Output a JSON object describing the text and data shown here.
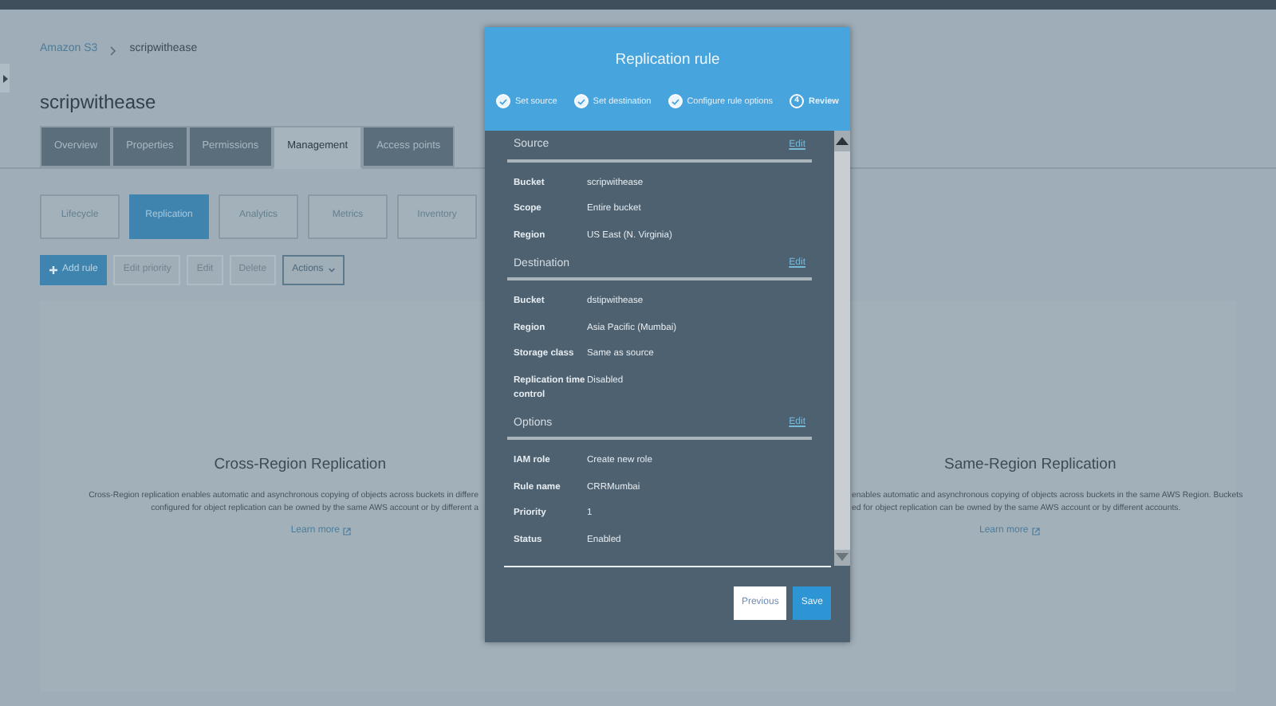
{
  "breadcrumb": [
    "Amazon S3",
    "scripwithease"
  ],
  "bucket_title": "scripwithease",
  "tabs": [
    {
      "label": "Overview",
      "selected": false
    },
    {
      "label": "Properties",
      "selected": false
    },
    {
      "label": "Permissions",
      "selected": false
    },
    {
      "label": "Management",
      "selected": true
    },
    {
      "label": "Access points",
      "selected": false
    }
  ],
  "sub_tabs": [
    {
      "label": "Lifecycle",
      "selected": false
    },
    {
      "label": "Replication",
      "selected": true
    },
    {
      "label": "Analytics",
      "selected": false
    },
    {
      "label": "Metrics",
      "selected": false
    },
    {
      "label": "Inventory",
      "selected": false
    }
  ],
  "toolbar": [
    {
      "label": "Add rule",
      "kind": "primary",
      "disabled": false
    },
    {
      "label": "Edit priority",
      "kind": "plain",
      "disabled": true
    },
    {
      "label": "Edit",
      "kind": "plain",
      "disabled": true
    },
    {
      "label": "Delete",
      "kind": "plain",
      "disabled": true
    },
    {
      "label": "Actions",
      "kind": "dropdown",
      "disabled": false
    }
  ],
  "cards": [
    {
      "title": "Cross-Region Replication",
      "description_lines": [
        "Cross-Region replication enables automatic and asynchronous copying of objects across buckets in differe",
        "configured for object replication can be owned by the same AWS account or by different a"
      ],
      "link": "Learn more"
    },
    {
      "title": "Same-Region Replication",
      "description_lines": [
        "enables automatic and asynchronous copying of objects across buckets in the same AWS Region. Buckets",
        "ed for object replication can be owned by the same AWS account or by different accounts."
      ],
      "link": "Learn more"
    }
  ],
  "modal": {
    "title": "Replication rule",
    "steps": [
      {
        "label": "Set source",
        "done": true,
        "selected": false
      },
      {
        "label": "Set destination",
        "done": true,
        "selected": false
      },
      {
        "label": "Configure rule options",
        "done": true,
        "selected": false
      },
      {
        "label": "Review",
        "done": false,
        "selected": true,
        "number": "4"
      }
    ],
    "sections": [
      {
        "title": "Source",
        "edit": "Edit",
        "fields": [
          {
            "label": "Bucket",
            "value": "scripwithease"
          },
          {
            "label": "Scope",
            "value": "Entire bucket"
          },
          {
            "label": "Region",
            "value": "US East (N. Virginia)"
          }
        ]
      },
      {
        "title": "Destination",
        "edit": "Edit",
        "fields": [
          {
            "label": "Bucket",
            "value": "dstipwithease"
          },
          {
            "label": "Region",
            "value": "Asia Pacific (Mumbai)"
          },
          {
            "label": "Storage class",
            "value": "Same as source"
          },
          {
            "label": "Replication time control",
            "value": "Disabled"
          }
        ]
      },
      {
        "title": "Options",
        "edit": "Edit",
        "fields": [
          {
            "label": "IAM role",
            "value": "Create new role"
          },
          {
            "label": "Rule name",
            "value": "CRRMumbai"
          },
          {
            "label": "Priority",
            "value": "1"
          },
          {
            "label": "Status",
            "value": "Enabled"
          }
        ]
      }
    ],
    "buttons": [
      {
        "label": "Previous",
        "primary": false
      },
      {
        "label": "Save",
        "primary": true
      }
    ]
  }
}
